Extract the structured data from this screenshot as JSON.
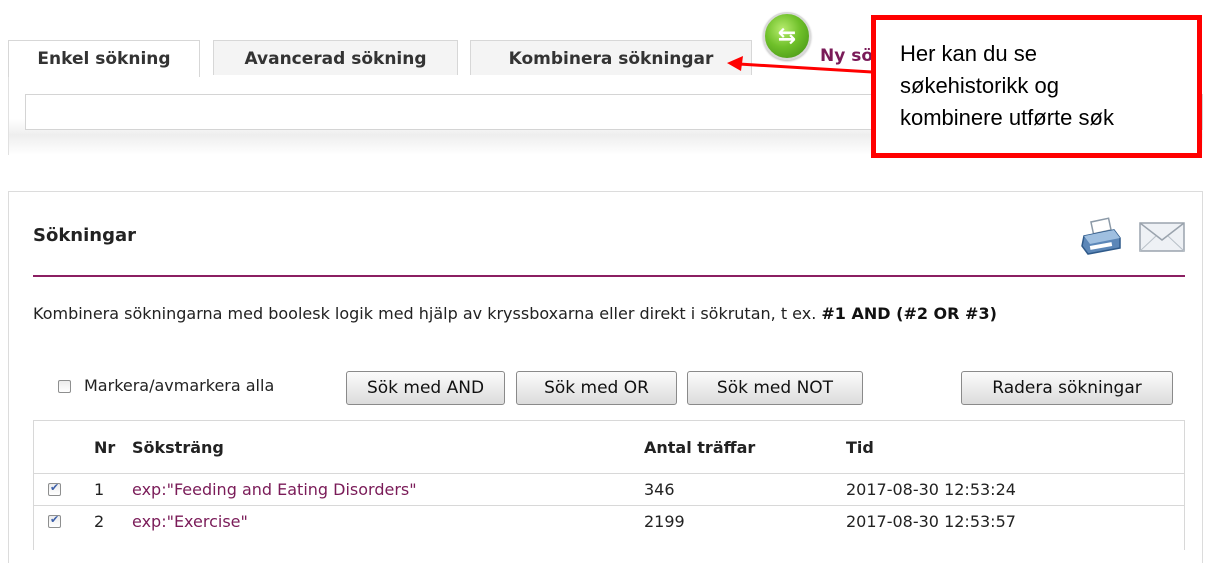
{
  "tabs": [
    {
      "label": "Enkel sökning"
    },
    {
      "label": "Avancerad sökning"
    },
    {
      "label": "Kombinera sökningar"
    }
  ],
  "ny_search_label": "Ny sö",
  "callout": {
    "line1": "Her kan du se",
    "line2": "søkehistorikk og",
    "line3": "kombinere utførte søk"
  },
  "panel": {
    "title": "Sökningar",
    "instructions_text": "Kombinera sökningarna med boolesk logik med hjälp av kryssboxarna eller direkt i sökrutan, t ex. ",
    "instructions_example": "#1 AND (#2 OR #3)",
    "select_all_label": "Markera/avmarkera alla",
    "buttons": {
      "and": "Sök med AND",
      "or": "Sök med OR",
      "not": "Sök med NOT",
      "delete": "Radera sökningar"
    }
  },
  "table": {
    "headers": {
      "nr": "Nr",
      "search_string": "Söksträng",
      "hits": "Antal träffar",
      "time": "Tid"
    },
    "rows": [
      {
        "nr": "1",
        "search_string": "exp:\"Feeding and Eating Disorders\"",
        "hits": "346",
        "time": "2017-08-30 12:53:24",
        "checked": true
      },
      {
        "nr": "2",
        "search_string": "exp:\"Exercise\"",
        "hits": "2199",
        "time": "2017-08-30 12:53:57",
        "checked": true
      }
    ]
  },
  "colors": {
    "accent": "#7a1b58",
    "callout_border": "#ff0000",
    "refresh_green": "#6fc02a"
  },
  "icons": [
    "refresh-icon",
    "printer-icon",
    "mail-icon",
    "arrow-icon"
  ]
}
